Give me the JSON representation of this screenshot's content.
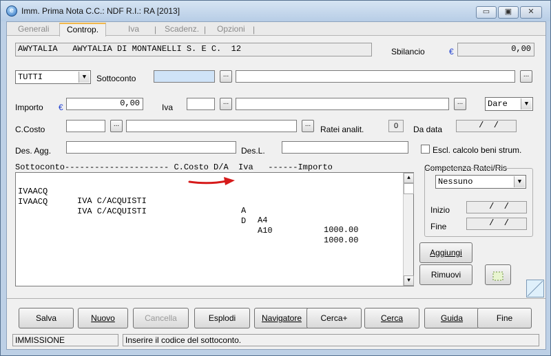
{
  "window": {
    "title": "Imm. Prima Nota C.C.: NDF  R.I.: RA  [2013]",
    "minimize_symbol": "▭",
    "restore_symbol": "▣",
    "close_symbol": "✕",
    "app_icon_glyph": "e"
  },
  "tabs": [
    {
      "label": "Generali"
    },
    {
      "label": "Controp."
    },
    {
      "label": "Iva"
    },
    {
      "label": "Scadenz."
    },
    {
      "label": "Opzioni"
    }
  ],
  "tab_separator": "|",
  "header": {
    "company": "AWYTALIA   AWYTALIA DI MONTANELLI S. E C.  12",
    "sbilancio_label": "Sbilancio",
    "currency": "€",
    "sbilancio_value": "0,00"
  },
  "filter": {
    "type_value": "TUTTI",
    "sottoconto_label": "Sottoconto",
    "sottoconto_code": "",
    "sottoconto_desc": ""
  },
  "importo": {
    "label": "Importo",
    "value": "0,00",
    "iva_label": "Iva",
    "iva_code": "",
    "iva_desc": "",
    "dare_avere": "Dare"
  },
  "ccosto": {
    "label": "C.Costo",
    "code": "",
    "desc": "",
    "ratei_label": "Ratei analit.",
    "ratei_value": "0",
    "da_data_label": "Da data",
    "da_data_value": " /  /"
  },
  "desagg": {
    "label": "Des. Agg.",
    "value": "",
    "desl_label": "Des.L.",
    "desl_value": "",
    "escl_label": "Escl. calcolo beni strum."
  },
  "list": {
    "header": "Sottoconto--------------------- C.Costo D/A  Iva   ------Importo",
    "rows": [
      {
        "code": "IVAACQ",
        "desc": "IVA C/ACQUISTI",
        "da": "A",
        "iva": "A4",
        "importo": "1000.00"
      },
      {
        "code": "IVAACQ",
        "desc": "IVA C/ACQUISTI",
        "da": "D",
        "iva": "A10",
        "importo": "1000.00"
      }
    ]
  },
  "competenza": {
    "title": "Competenza Ratei/Ris",
    "value": "Nessuno",
    "inizio_label": "Inizio",
    "inizio_value": " /  /",
    "fine_label": "Fine",
    "fine_value": " /  /"
  },
  "side_buttons": {
    "aggiungi": "Aggiungi",
    "rimuovi": "Rimuovi"
  },
  "ellipsis": "...",
  "combo_arrow": "▼",
  "scroll_up": "▲",
  "scroll_down": "▼",
  "toolbar": [
    {
      "key": "salva",
      "label": "Salva",
      "enabled": true
    },
    {
      "key": "nuovo",
      "label": "Nuovo",
      "enabled": true
    },
    {
      "key": "cancella",
      "label": "Cancella",
      "enabled": false
    },
    {
      "key": "esplodi",
      "label": "Esplodi",
      "enabled": true
    },
    {
      "key": "navigatore",
      "label": "Navigatore",
      "enabled": true
    },
    {
      "key": "cerca_plus",
      "label": "Cerca+",
      "enabled": true
    },
    {
      "key": "cerca",
      "label": "Cerca",
      "enabled": true
    },
    {
      "key": "guida",
      "label": "Guida",
      "enabled": true
    },
    {
      "key": "fine",
      "label": "Fine",
      "enabled": true
    }
  ],
  "statusbar": {
    "mode": "IMMISSIONE",
    "message": "Inserire il codice del sottoconto."
  },
  "colors": {
    "arrow": "#d61a1a",
    "euro": "#1f3fd0",
    "tab_active_accent": "#f2b84b"
  }
}
